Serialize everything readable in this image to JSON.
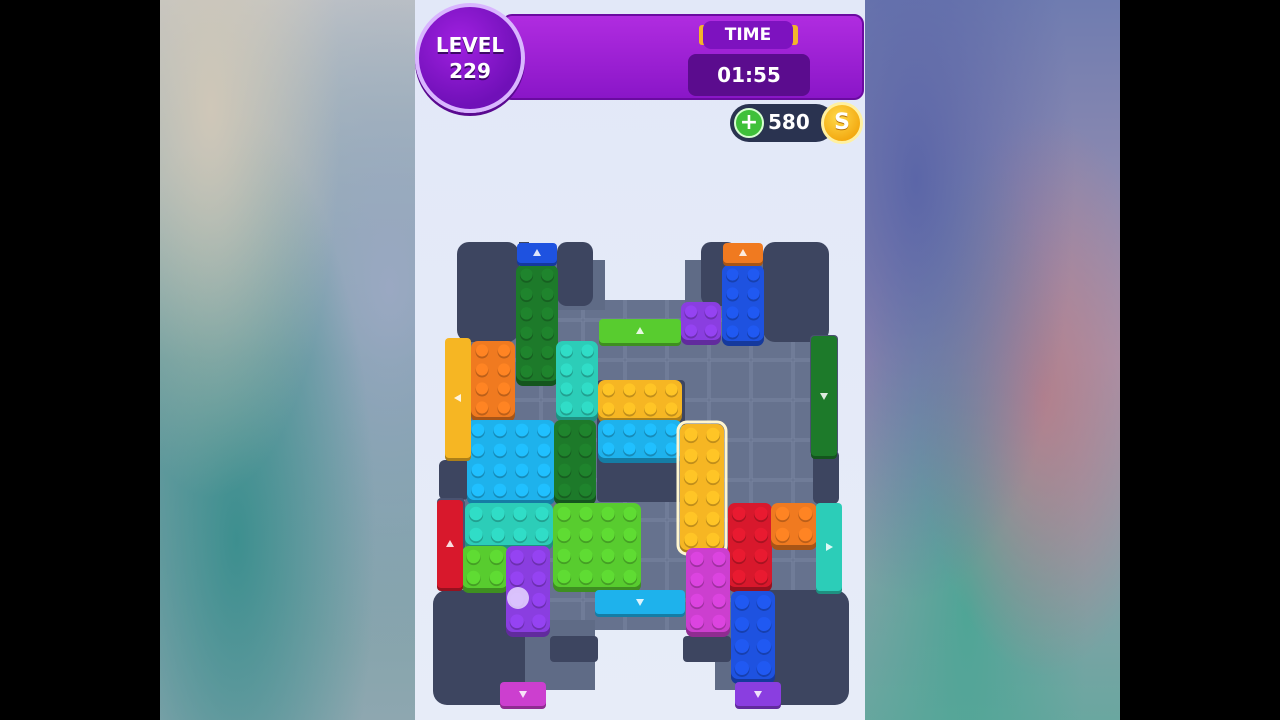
{
  "hud": {
    "level_label": "LEVEL",
    "level_number": "229",
    "time_label": "TIME",
    "timer_value": "01:55",
    "coins": "580",
    "plus_symbol": "+",
    "coin_symbol": "S",
    "restart_icon": "restart-icon"
  },
  "colors": {
    "hud_purple": "#9a1fd6",
    "block_orange": "#f07a20",
    "block_dark_green": "#1d7a2a",
    "block_teal": "#2ccdb8",
    "block_yellow": "#f6b623",
    "block_cyan": "#1eb2ec",
    "block_lime": "#58cc2f",
    "block_purple": "#8a3ee0",
    "block_magenta": "#cc3fcf",
    "block_red": "#d8182c",
    "block_blue": "#1e52e0",
    "board_floor": "#5f6b86",
    "board_wall": "#3d4560"
  },
  "board": {
    "blocks": [
      {
        "name": "dark-green-block-top",
        "color": "block_dark_green"
      },
      {
        "name": "blue-block-top",
        "color": "block_blue"
      },
      {
        "name": "purple-block-small",
        "color": "block_purple"
      },
      {
        "name": "orange-block-left",
        "color": "block_orange"
      },
      {
        "name": "teal-block-vertical",
        "color": "block_teal"
      },
      {
        "name": "yellow-block-horizontal",
        "color": "block_yellow"
      },
      {
        "name": "cyan-block-large",
        "color": "block_cyan"
      },
      {
        "name": "dark-green-block-middle",
        "color": "block_dark_green"
      },
      {
        "name": "cyan-block-horizontal",
        "color": "block_cyan"
      },
      {
        "name": "yellow-block-selected",
        "color": "block_yellow"
      },
      {
        "name": "teal-block-horizontal",
        "color": "block_teal"
      },
      {
        "name": "lime-block-large",
        "color": "block_lime"
      },
      {
        "name": "red-block",
        "color": "block_red"
      },
      {
        "name": "orange-block-right",
        "color": "block_orange"
      },
      {
        "name": "lime-block-small",
        "color": "block_lime"
      },
      {
        "name": "purple-block-bottom",
        "color": "block_purple"
      },
      {
        "name": "magenta-block",
        "color": "block_magenta"
      },
      {
        "name": "blue-block-bottom",
        "color": "block_blue"
      }
    ],
    "exits": [
      {
        "name": "blue-exit-top",
        "color": "block_blue"
      },
      {
        "name": "orange-exit-top",
        "color": "block_orange"
      },
      {
        "name": "lime-exit-top",
        "color": "block_lime"
      },
      {
        "name": "yellow-exit-left",
        "color": "block_yellow"
      },
      {
        "name": "red-exit-left",
        "color": "block_red"
      },
      {
        "name": "green-exit-right",
        "color": "block_dark_green"
      },
      {
        "name": "teal-exit-right",
        "color": "block_teal"
      },
      {
        "name": "cyan-exit-bottom",
        "color": "block_cyan"
      },
      {
        "name": "magenta-exit-bottom",
        "color": "block_magenta"
      },
      {
        "name": "purple-exit-bottom",
        "color": "block_purple"
      }
    ]
  }
}
